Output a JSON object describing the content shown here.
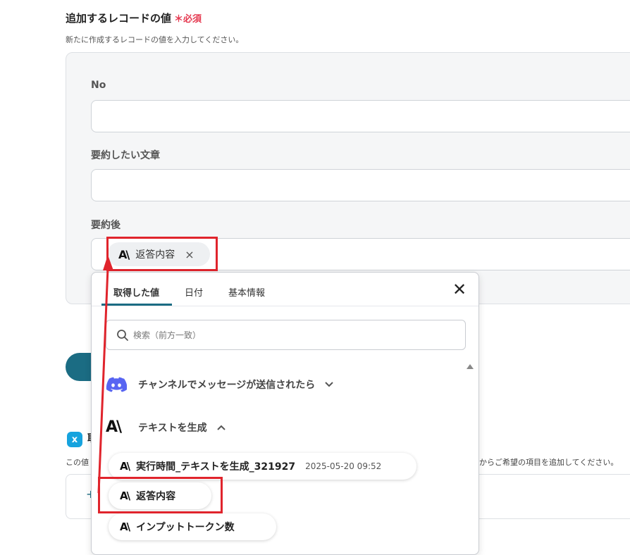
{
  "section": {
    "title": "追加するレコードの値",
    "required": "＊必須",
    "description": "新たに作成するレコードの値を入力してください。"
  },
  "fields": {
    "no_label": "No",
    "summary_source_label": "要約したい文章",
    "summary_after_label": "要約後",
    "chip_label": "返答内容",
    "chip_close": "×"
  },
  "background": {
    "x_icon_glyph": "x",
    "heading_fragment": "取",
    "desc_left": "この値",
    "desc_right": "からご希望の項目を追加してください。",
    "plus": "+"
  },
  "dropdown": {
    "tabs": [
      "取得した値",
      "日付",
      "基本情報"
    ],
    "active_tab": "取得した値",
    "close": "✕",
    "search_placeholder": "検索（前方一致）",
    "groups": [
      {
        "label": "チャンネルでメッセージが送信されたら",
        "icon": "discord-icon",
        "expanded": false
      },
      {
        "label": "テキストを生成",
        "icon": "anthropic-icon",
        "expanded": true
      }
    ],
    "items": [
      {
        "label": "実行時間_テキストを生成_321927",
        "timestamp": "2025-05-20 09:52"
      },
      {
        "label": "返答内容"
      },
      {
        "label": "インプットトークン数"
      }
    ]
  },
  "logo_text": "A\\",
  "colors": {
    "accent": "#1b6c83",
    "required": "#e53950",
    "highlight": "#e0242c",
    "discord": "#5865f2"
  }
}
